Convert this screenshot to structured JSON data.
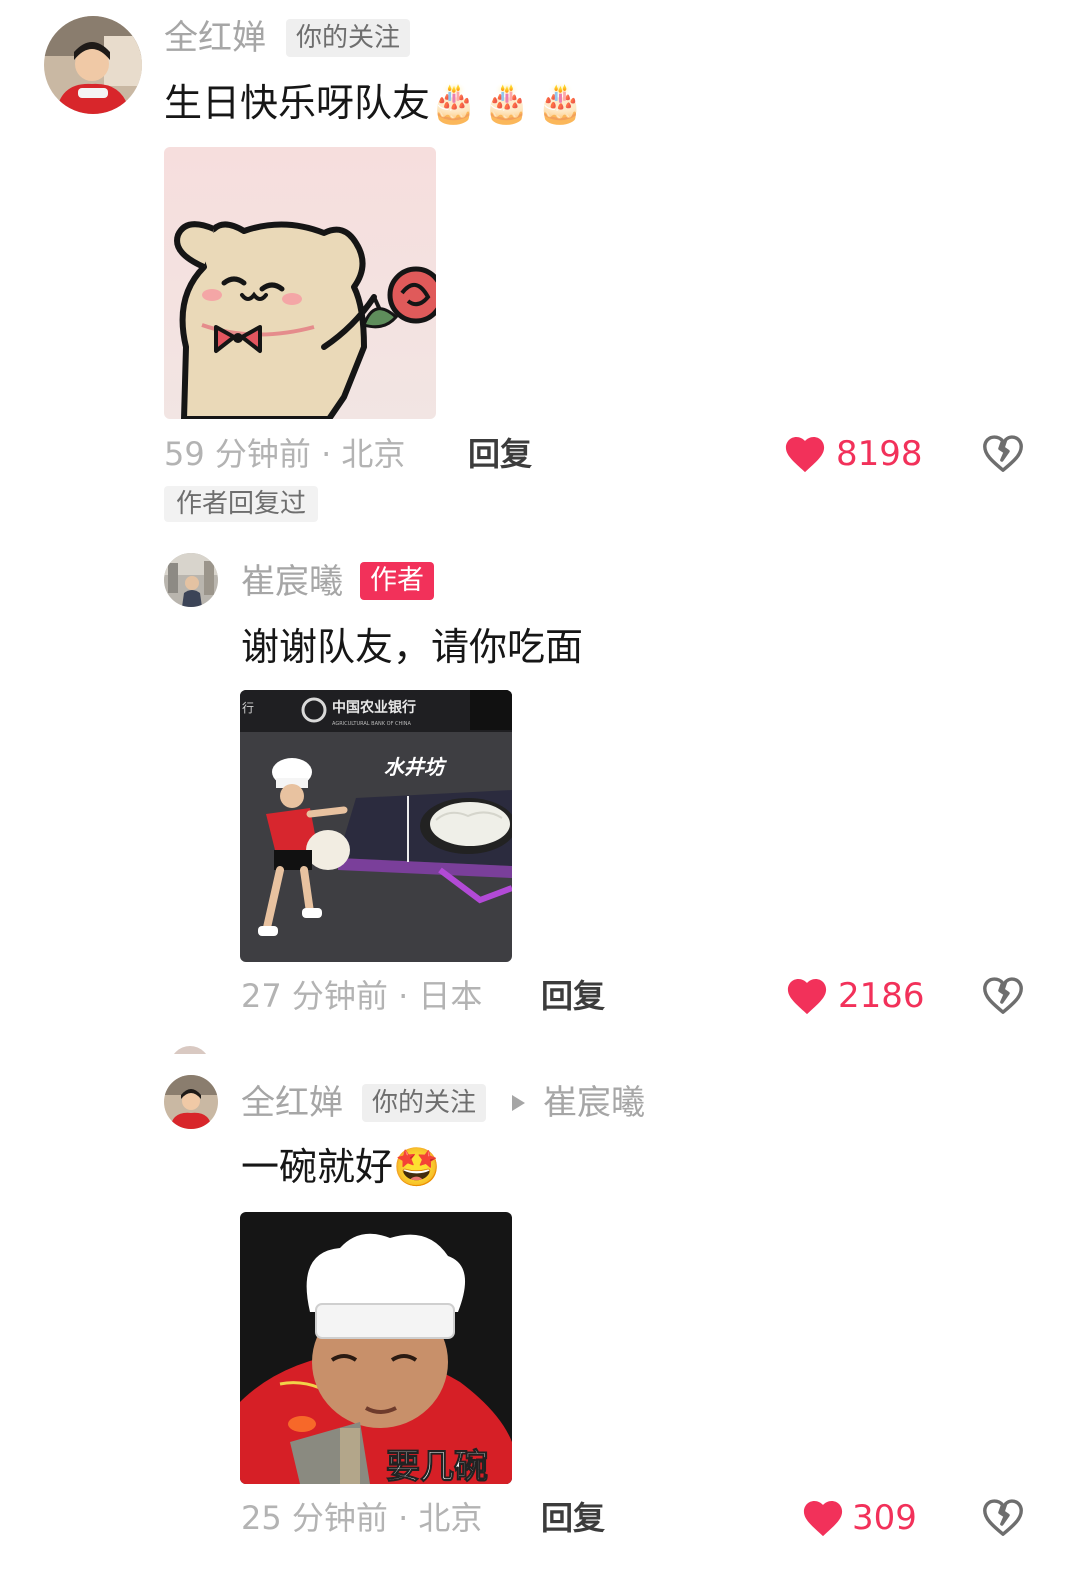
{
  "comments": [
    {
      "user": "全红婵",
      "tag": "你的关注",
      "text": "生日快乐呀队友",
      "emoji": "🎂🎂🎂",
      "time_location": "59 分钟前 · 北京",
      "reply_label": "回复",
      "likes": "8198",
      "author_replied": "作者回复过"
    },
    {
      "user": "崔宸曦",
      "tag": "作者",
      "text": "谢谢队友，请你吃面",
      "image_text": {
        "bank": "中国农业银行",
        "bank_en": "AGRICULTURAL BANK OF CHINA",
        "brand": "水井坊",
        "side": "行"
      },
      "time_location": "27 分钟前 · 日本",
      "reply_label": "回复",
      "likes": "2186"
    },
    {
      "user": "全红婵",
      "tag": "你的关注",
      "reply_to": "崔宸曦",
      "text": "一碗就好",
      "emoji": "🤩",
      "image_caption": "要几碗",
      "time_location": "25 分钟前 · 北京",
      "reply_label": "回复",
      "likes": "309"
    }
  ],
  "colors": {
    "accent": "#f2315a",
    "meta": "#b3b3b3",
    "username": "#a6a6a6"
  },
  "icons": {
    "like": "heart-icon",
    "dislike": "broken-heart-icon"
  }
}
